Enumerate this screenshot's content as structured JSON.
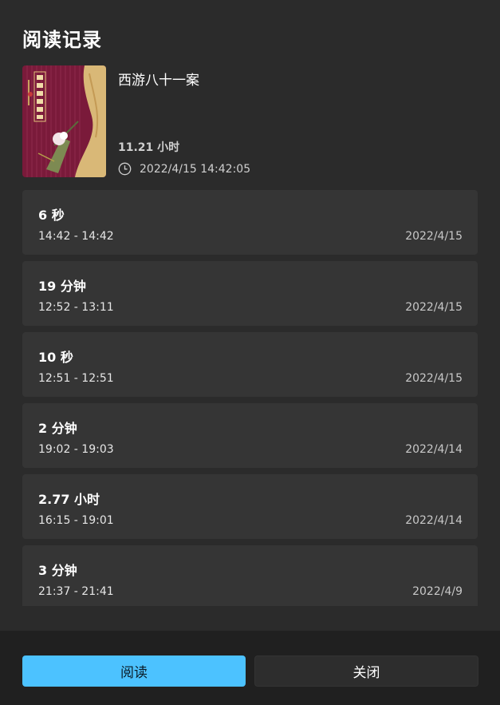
{
  "dialog": {
    "title": "阅读记录"
  },
  "book": {
    "title": "西游八十一案",
    "total_time": "11.21 小时",
    "last_read": "2022/4/15 14:42:05",
    "clock_icon": "clock-icon",
    "cover": {
      "title_chars": "西游八十一案",
      "bg_color": "#7a1a3a",
      "accent_color": "#e2c27a"
    }
  },
  "records": [
    {
      "duration": "6 秒",
      "range": "14:42 - 14:42",
      "date": "2022/4/15"
    },
    {
      "duration": "19 分钟",
      "range": "12:52 - 13:11",
      "date": "2022/4/15"
    },
    {
      "duration": "10 秒",
      "range": "12:51 - 12:51",
      "date": "2022/4/15"
    },
    {
      "duration": "2 分钟",
      "range": "19:02 - 19:03",
      "date": "2022/4/14"
    },
    {
      "duration": "2.77 小时",
      "range": "16:15 - 19:01",
      "date": "2022/4/14"
    },
    {
      "duration": "3 分钟",
      "range": "21:37 - 21:41",
      "date": "2022/4/9"
    }
  ],
  "buttons": {
    "read_label": "阅读",
    "close_label": "关闭",
    "accent": "#4cc2ff"
  }
}
